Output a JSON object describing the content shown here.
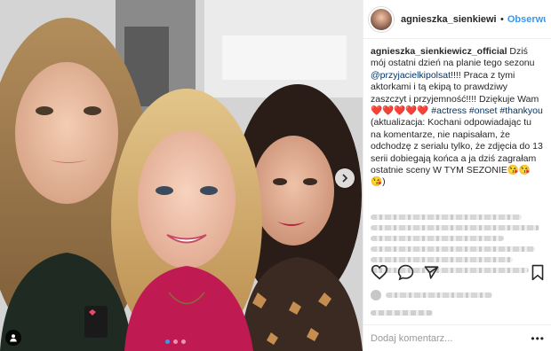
{
  "post": {
    "username": "agnieszka_sienkiewicz_",
    "separator": "•",
    "follow_label": "Obserwuj",
    "caption": {
      "author": "agnieszka_sienkiewicz_official",
      "text1": " Dziś mój ostatni dzień na planie tego sezonu ",
      "mention": "@przyjacielkipolsat",
      "text2": "!!!! Praca z tymi aktorkami i tą ekipą to prawdziwy zaszczyt i przyjemność!!!! Dziękuje Wam",
      "hearts": "❤️❤️❤️❤️❤️",
      "hashtag1": "#actress",
      "hashtag2": "#onset",
      "hashtag3": "#thankyou",
      "text3": "(aktualizacja: Kochani odpowiadając tu na komentarze, nie napisałam, że odchodzę z serialu tylko, że zdjęcia do 13 serii dobiegają końca a ja dziś zagrałam ostatnie sceny W TYM SEZONIE",
      "emoji_end": "😘😘😘)"
    },
    "comment_placeholder": "Dodaj komentarz...",
    "more_label": "•••"
  },
  "icons": {
    "like": "heart-outline-icon",
    "comment": "comment-bubble-icon",
    "share": "share-icon",
    "save": "bookmark-icon",
    "carousel_next": "chevron-right-icon",
    "tag": "user-tag-icon"
  },
  "colors": {
    "link": "#003569",
    "follow": "#3897f0",
    "text": "#262626",
    "placeholder": "#999999"
  },
  "carousel": {
    "count": 3,
    "active": 1
  }
}
